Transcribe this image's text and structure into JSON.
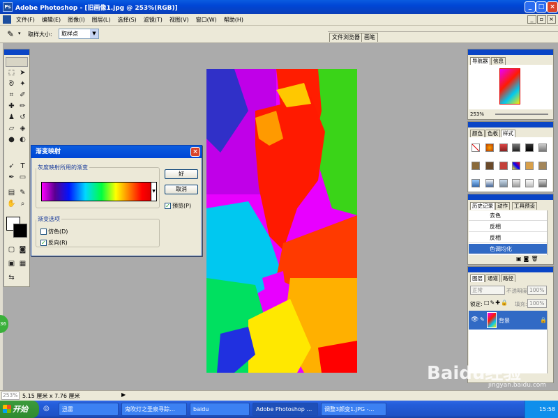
{
  "window": {
    "title": "Adobe Photoshop - [旧画像1.jpg @ 253%(RGB)]"
  },
  "menu": [
    "文件(F)",
    "编辑(E)",
    "图像(I)",
    "图层(L)",
    "选择(S)",
    "滤镜(T)",
    "视图(V)",
    "窗口(W)",
    "帮助(H)"
  ],
  "options": {
    "sample_label": "取样大小:",
    "sample_value": "取样点"
  },
  "well_tabs": [
    "文件浏览器",
    "画笔"
  ],
  "dialog": {
    "title": "渐变映射",
    "group1": "灰度映射所用的渐变",
    "group2": "渐变选项",
    "dither": "仿色(D)",
    "reverse": "反向(R)",
    "ok": "好",
    "cancel": "取消",
    "preview": "预览(P)",
    "gradient_colors": [
      "#ff00ff",
      "#5a0090",
      "#0014ff",
      "#00d8ff",
      "#00ff40",
      "#ffff00",
      "#ff8000",
      "#ff0000"
    ]
  },
  "navigator": {
    "tabs": [
      "导航器",
      "信息"
    ],
    "zoom": "253%"
  },
  "color_palette": {
    "tabs": [
      "颜色",
      "色板",
      "样式"
    ]
  },
  "history": {
    "tabs": [
      "历史记录",
      "动作",
      "工具预设"
    ],
    "items": [
      "去色",
      "反相",
      "反相",
      "色调均化"
    ]
  },
  "layers": {
    "tabs": [
      "图层",
      "通道",
      "路径"
    ],
    "blend_mode": "正常",
    "opacity_label": "不透明度:",
    "opacity": "100%",
    "lock_label": "锁定:",
    "fill_label": "填充:",
    "fill": "100%",
    "layer_name": "背景"
  },
  "status": {
    "zoom": "253%",
    "doc_size": "5.15 厘米 x 7.76 厘米"
  },
  "taskbar": {
    "start": "开始",
    "tasks": [
      "迅雷",
      "鬼吹灯之圣泉寻踪…",
      "baidu",
      "Adobe Photoshop …",
      "调整3颜变1.JPG -…"
    ],
    "clock": "15:58"
  },
  "watermark": {
    "brand": "Baidu经验",
    "url": "jingyan.baidu.com"
  },
  "badge": "36"
}
